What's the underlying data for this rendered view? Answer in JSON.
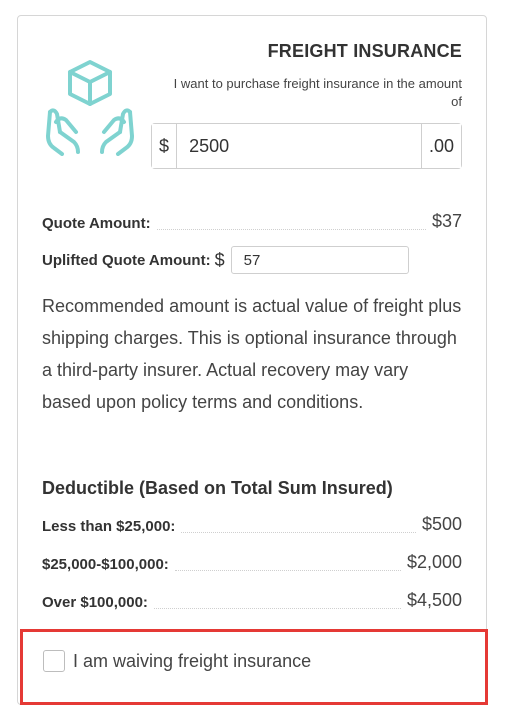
{
  "header": {
    "title": "FREIGHT INSURANCE",
    "subtitle": "I want to purchase freight insurance in the amount of",
    "icon": "hands-holding-box-icon"
  },
  "amount": {
    "prefix": "$",
    "value": "2500",
    "suffix": ".00"
  },
  "quote": {
    "label": "Quote Amount:",
    "value": "$37"
  },
  "uplift": {
    "label": "Uplifted Quote Amount:",
    "currency": "$",
    "value": "57"
  },
  "note": "Recommended amount is actual value of freight plus shipping charges. This is optional insurance through a third-party insurer. Actual recovery may vary based upon policy terms and conditions.",
  "deductible": {
    "heading": "Deductible (Based on Total Sum Insured)",
    "rows": [
      {
        "label": "Less than $25,000:",
        "value": "$500"
      },
      {
        "label": "$25,000-$100,000:",
        "value": "$2,000"
      },
      {
        "label": "Over $100,000:",
        "value": "$4,500"
      }
    ]
  },
  "waiver": {
    "label": "I am waiving freight insurance",
    "checked": false
  },
  "colors": {
    "icon": "#7fd3d0",
    "highlight": "#e53935",
    "border": "#d6d6d6"
  }
}
